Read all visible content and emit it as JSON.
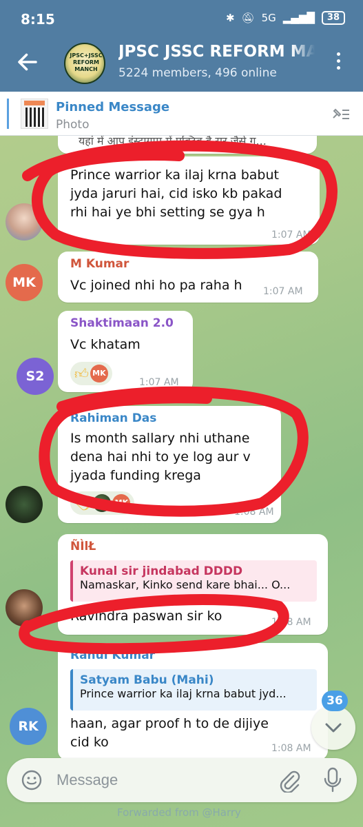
{
  "status": {
    "time": "8:15",
    "battery": "38",
    "network": "5G"
  },
  "header": {
    "title": "JPSC JSSC REFORM MANCH",
    "subtitle": "5224 members, 496 online",
    "avatar_text": "JPSC+JSSC REFORM MANCH"
  },
  "pinned": {
    "title": "Pinned Message",
    "subtitle": "Photo"
  },
  "messages": [
    {
      "text_top": "यहां में आप इंस्टाग्राम में एक्टिव है सर जैसे गु..."
    },
    {
      "text": "Prince warrior ka ilaj krna babut jyda jaruri hai, cid isko kb pakad rhi hai ye bhi setting se gya h",
      "line1": "Prince warrior ka ilaj krna babut",
      "line2": "jyda jaruri hai, cid isko kb pakad",
      "line3": "rhi hai ye bhi setting se gya h",
      "time": "1:07 AM"
    },
    {
      "sender": "M Kumar",
      "avatar": "MK",
      "text": "Vc joined nhi ho pa raha h",
      "time": "1:07 AM"
    },
    {
      "sender": "Shaktimaan 2.0",
      "avatar": "S2",
      "text": "Vc khatam",
      "time": "1:07 AM",
      "reaction_badge": "MK"
    },
    {
      "sender": "Rahiman Das",
      "line1": "Is month sallary nhi uthane",
      "line2": "dena hai nhi to ye log aur v",
      "line3": "jyada funding krega",
      "time": "1:08 AM",
      "reaction_badge": "MK"
    },
    {
      "sender": "ÑÌlŁ",
      "quote_name": "Kunal sir jindabad DDDD",
      "quote_text": "Namaskar, Kinko send kare bhai... O...",
      "text": "Ravindra paswan sir  ko",
      "time": "1:08 AM"
    },
    {
      "sender": "Rahul Kumar",
      "avatar": "RK",
      "quote_name": "Satyam Babu (Mahi)",
      "quote_text": "Prince warrior ka ilaj krna babut jyd...",
      "line1": "haan, agar proof h to de dijiye",
      "line2": "cid ko",
      "time": "1:08 AM"
    }
  ],
  "scroll": {
    "unread": "36"
  },
  "input": {
    "placeholder": "Message"
  },
  "below_text": "Forwarded from @Harry"
}
